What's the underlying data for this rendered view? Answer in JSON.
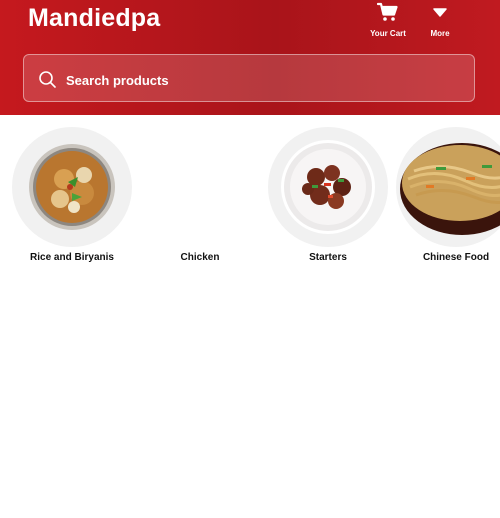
{
  "header": {
    "brand": "Mandiedpa",
    "actions": [
      {
        "label": "Your Cart",
        "icon": "cart-icon"
      },
      {
        "label": "More",
        "icon": "chevron-down-icon"
      }
    ]
  },
  "search": {
    "placeholder": "Search products",
    "icon": "search-icon"
  },
  "categories": [
    {
      "name": "Rice and Biryanis",
      "image": "biryani-plate"
    },
    {
      "name": "Chicken",
      "image": ""
    },
    {
      "name": "Starters",
      "image": "chilli-chicken-plate"
    },
    {
      "name": "Chinese Food",
      "image": "noodles-bowl"
    }
  ],
  "colors": {
    "header_bg": "#b3161c",
    "text_white": "#ffffff"
  }
}
